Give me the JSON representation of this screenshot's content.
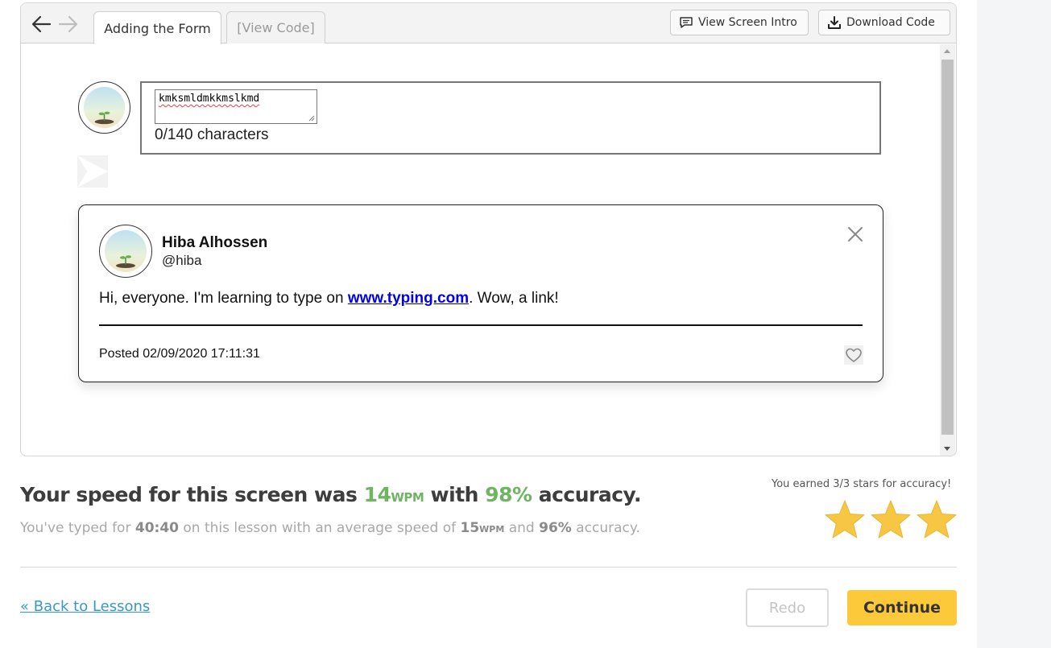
{
  "browser": {
    "tabs": [
      {
        "label": "Adding the Form",
        "active": true
      },
      {
        "label": "[View Code]",
        "active": false
      }
    ],
    "view_intro_label": "View Screen Intro",
    "download_label": "Download Code"
  },
  "composer": {
    "input_value": "kmksmldmkkmslkmd",
    "char_count": "0/140 characters"
  },
  "tweet": {
    "name": "Hiba Alhossen",
    "handle": "@hiba",
    "message_before": "Hi, everyone. I'm learning to type on ",
    "link_text": "www.typing.com",
    "message_after": ". Wow, a link!",
    "posted": "Posted 02/09/2020 17:11:31"
  },
  "results": {
    "speed_prefix": "Your speed for this screen was ",
    "speed_value": "14",
    "speed_unit": "WPM",
    "speed_mid": " with ",
    "accuracy_value": "98%",
    "accuracy_suffix": " accuracy.",
    "summary_prefix": "You've typed for ",
    "summary_time": "40:40",
    "summary_mid": " on this lesson with an average speed of ",
    "summary_speed": "15",
    "summary_unit": "WPM",
    "summary_and": " and ",
    "summary_accuracy": "96%",
    "summary_suffix": " accuracy.",
    "stars_caption": "You earned 3/3 stars for accuracy!",
    "stars_earned": 3,
    "stars_total": 3
  },
  "footer": {
    "back_label": "« Back to Lessons",
    "redo_label": "Redo",
    "continue_label": "Continue"
  },
  "colors": {
    "accent_green": "#6eb461",
    "continue_yellow": "#fbc93a",
    "star_gold": "#f7c744",
    "link_blue": "#3399cc"
  }
}
